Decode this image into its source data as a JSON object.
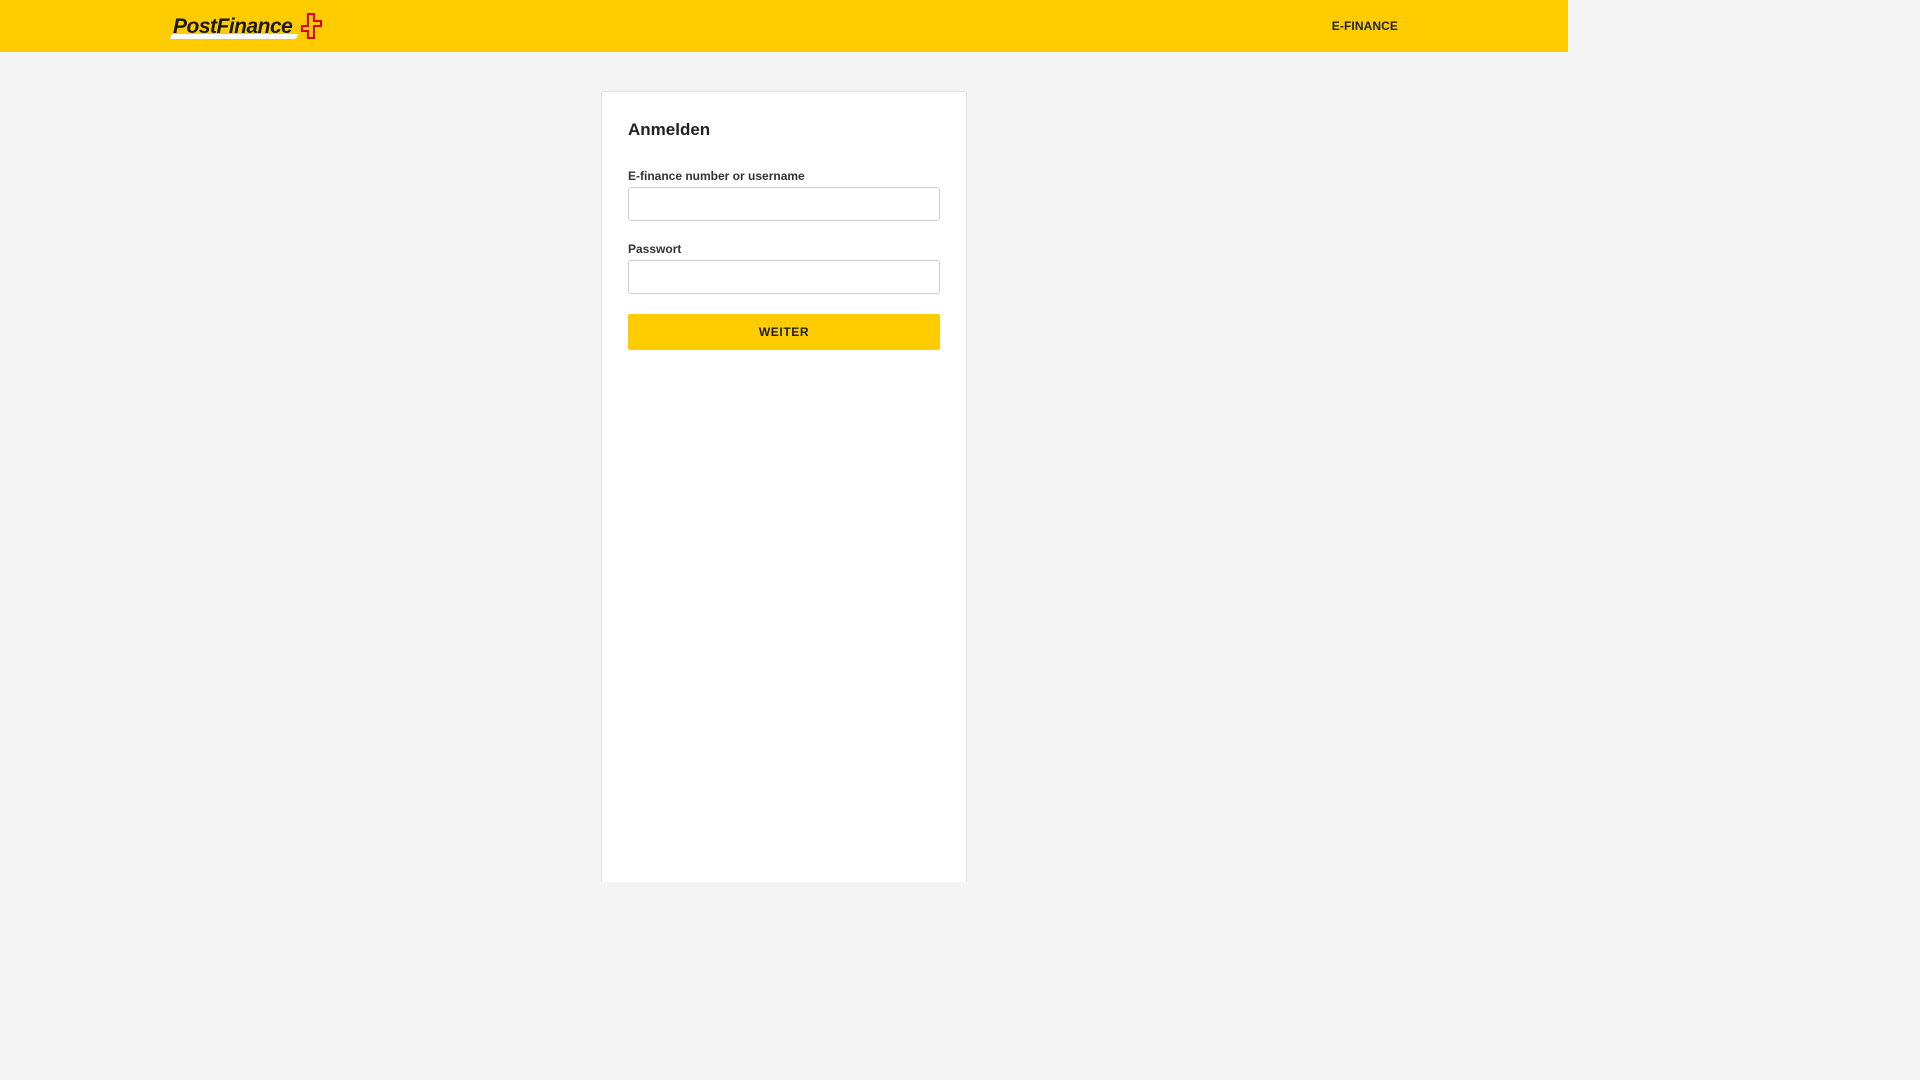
{
  "header": {
    "logo_text": "PostFinance",
    "nav_label": "E-FINANCE"
  },
  "login": {
    "title": "Anmelden",
    "username_label": "E-finance number or username",
    "username_value": "",
    "password_label": "Passwort",
    "password_value": "",
    "submit_label": "WEITER"
  },
  "colors": {
    "brand_yellow": "#ffcc00",
    "brand_red": "#e3001b",
    "page_background": "#f4f4f4"
  },
  "icons": {
    "logo_mark": "swiss-cross-icon"
  }
}
